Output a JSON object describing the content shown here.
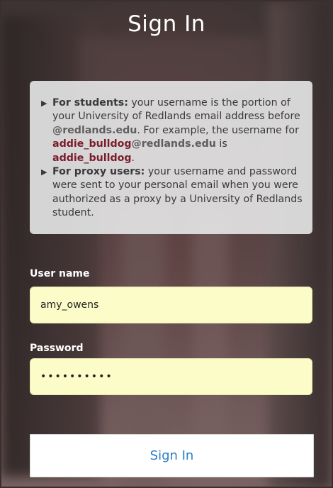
{
  "page": {
    "title": "Sign In"
  },
  "info": {
    "students": {
      "lead": "For students:",
      "text1": " your username is the portion of your University of Redlands email address before ",
      "domain": "@redlands.edu",
      "text2": ". For example, the username for ",
      "example_user": "addie_bulldog",
      "example_domain": "@redlands.edu",
      "text3": " is ",
      "result_user": "addie_bulldog",
      "text4": "."
    },
    "proxy": {
      "lead": "For proxy users:",
      "text": " your username and password were sent to your personal email when you were authorized as a proxy by a University of Redlands student."
    }
  },
  "form": {
    "username_label": "User name",
    "username_value": "amy_owens",
    "password_label": "Password",
    "password_value": "••••••••••",
    "submit_label": "Sign In"
  },
  "colors": {
    "accent_red": "#7a1c2a",
    "input_bg": "#fbfcc8",
    "button_text": "#2b7fc4"
  }
}
